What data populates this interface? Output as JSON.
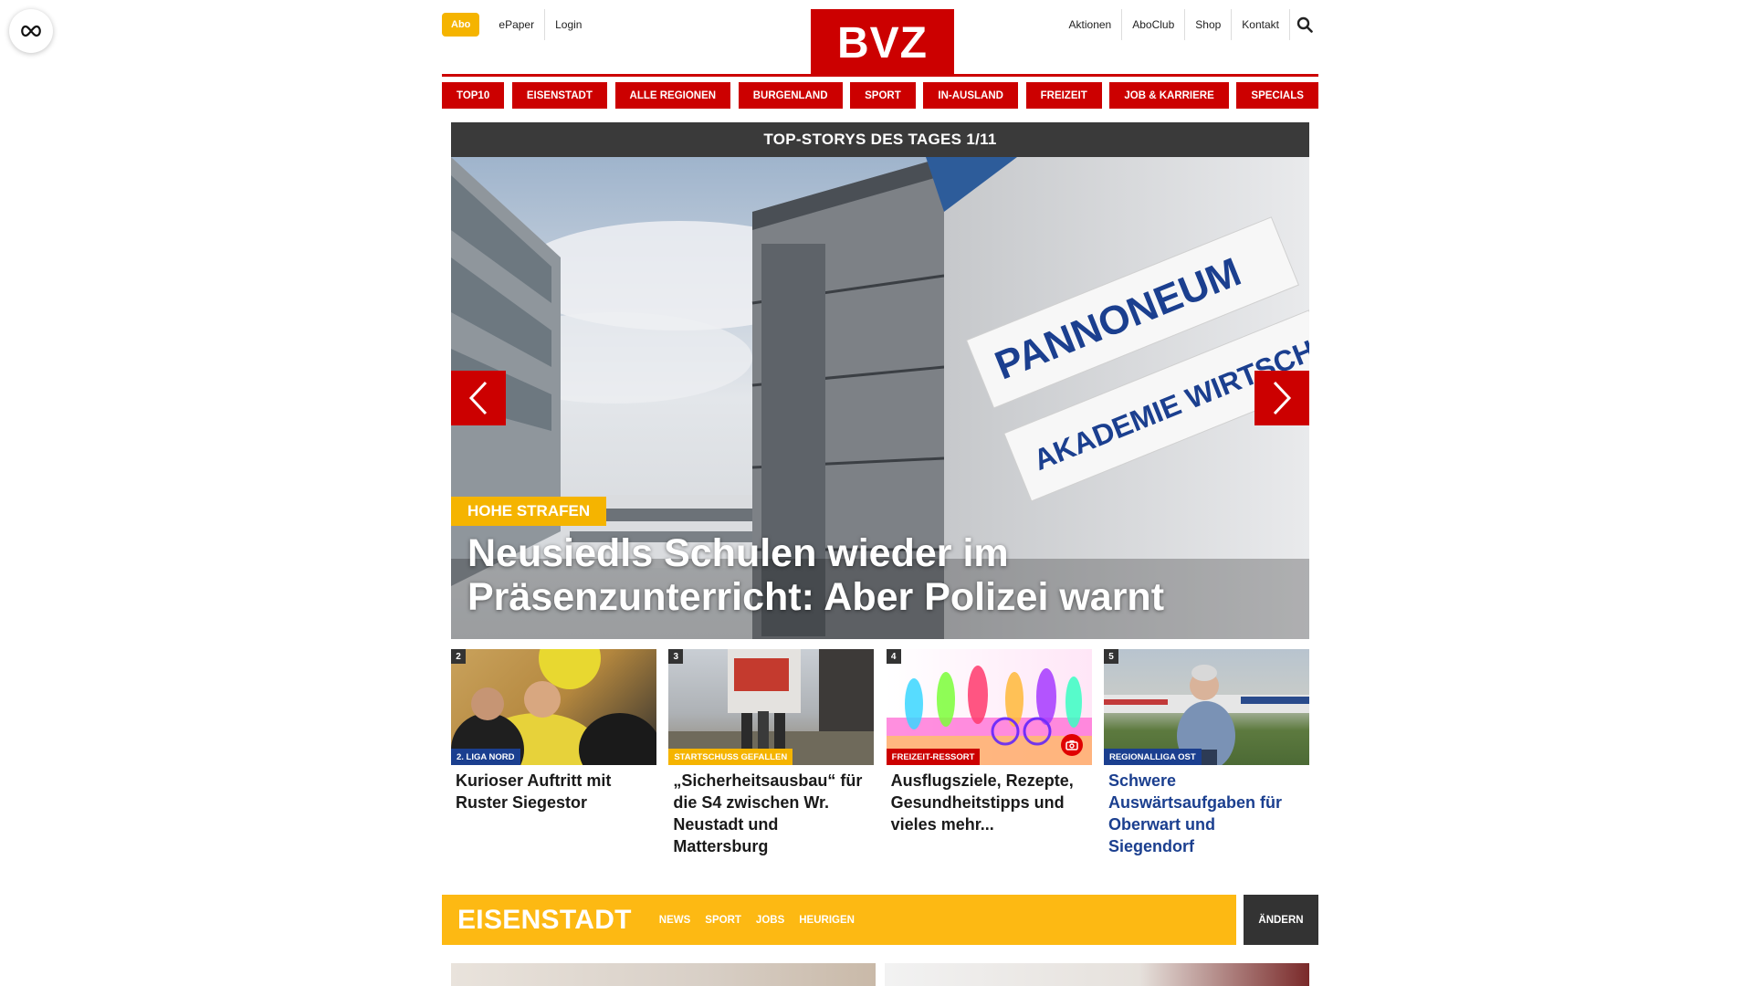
{
  "header": {
    "abo_label": "Abo",
    "left_links": [
      "ePaper",
      "Login"
    ],
    "logo_text": "BVZ",
    "right_links": [
      "Aktionen",
      "AboClub",
      "Shop",
      "Kontakt"
    ]
  },
  "nav": {
    "items": [
      "TOP10",
      "EISENSTADT",
      "ALLE REGIONEN",
      "BURGENLAND",
      "SPORT",
      "IN-AUSLAND",
      "FREIZEIT",
      "JOB & KARRIERE",
      "SPECIALS"
    ]
  },
  "hero": {
    "section_title": "TOP-STORYS DES TAGES 1/11",
    "kicker": "HOHE STRAFEN",
    "headline": "Neusiedls Schulen wieder im Präsenzunterricht: Aber Polizei warnt",
    "sign_text_1": "PANNONEUM",
    "sign_text_2": "AKADEMIE WIRTSCHAFT"
  },
  "cards": [
    {
      "num": "2",
      "kicker": "2. LIGA NORD",
      "kicker_color": "#1b3f8f",
      "title": "Kurioser Auftritt mit Ruster Siegestor",
      "title_color": "#1a1a1a"
    },
    {
      "num": "3",
      "kicker": "STARTSCHUSS GEFALLEN",
      "kicker_color": "#f5b400",
      "title": "„Sicherheitsausbau“ für die S4 zwischen Wr. Neustadt und Mattersburg",
      "title_color": "#1a1a1a"
    },
    {
      "num": "4",
      "kicker": "FREIZEIT-RESSORT",
      "kicker_color": "#cc0000",
      "title": "Ausflugsziele, Rezepte, Gesundheitstipps und vieles mehr...",
      "title_color": "#1a1a1a"
    },
    {
      "num": "5",
      "kicker": "REGIONALLIGA OST",
      "kicker_color": "#1b3f8f",
      "title": "Schwere Auswärtsaufgaben für Oberwart und Siegendorf",
      "title_color": "#1b3f8f"
    }
  ],
  "region": {
    "name": "EISENSTADT",
    "links": [
      "NEWS",
      "SPORT",
      "JOBS",
      "HEURIGEN"
    ],
    "change_label": "ÄNDERN"
  },
  "colors": {
    "brand_red": "#cc0000",
    "accent_yellow": "#f5b400",
    "dark_gray": "#3a3a3a",
    "link_blue": "#1b3f8f"
  }
}
